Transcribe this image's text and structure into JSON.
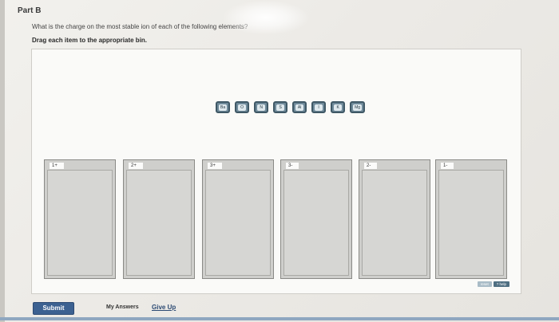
{
  "part": {
    "title": "Part B"
  },
  "question": {
    "text": "What is the charge on the most stable ion of each of the following elements?",
    "instruction": "Drag each item to the appropriate bin."
  },
  "tiles": [
    "Ba",
    "O",
    "N",
    "S",
    "Al",
    "I",
    "K",
    "Mg"
  ],
  "bins": [
    "1+",
    "2+",
    "3+",
    "3-",
    "2-",
    "1-"
  ],
  "controls": {
    "reset_label": "reset",
    "help_label": "? help"
  },
  "footer": {
    "submit_label": "Submit",
    "my_answers_label": "My Answers",
    "give_up_label": "Give Up"
  },
  "colors": {
    "submit": "#3c6191",
    "tile": "#6f8a9a",
    "bin": "#cfcfcc",
    "footer_line": "#8fa7c0"
  }
}
